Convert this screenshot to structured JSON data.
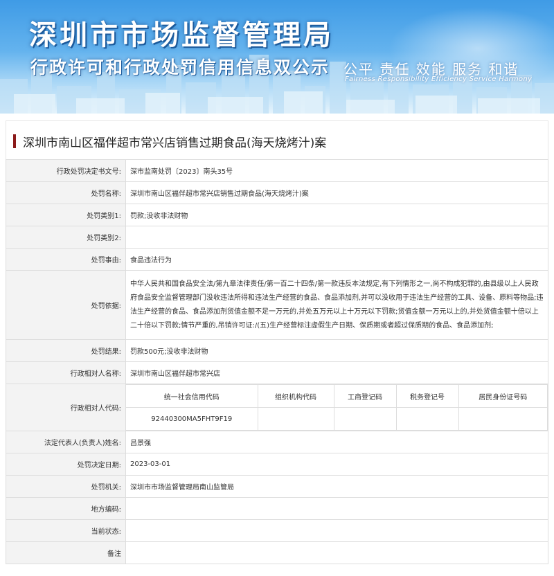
{
  "header": {
    "title": "深圳市市场监督管理局",
    "subtitle": "行政许可和行政处罚信用信息双公示",
    "slogan_cn": "公平  责任  效能  服务  和谐",
    "slogan_en": "Fairness Responsibility Efficiency Service Harmony"
  },
  "case_title": "深圳市南山区福伴超市常兴店销售过期食品(海天烧烤汁)案",
  "fields": {
    "doc_no": {
      "label": "行政处罚决定书文号:",
      "value": "深市监南处罚〔2023〕南头35号"
    },
    "name": {
      "label": "处罚名称:",
      "value": "深圳市南山区福伴超市常兴店销售过期食品(海天烧烤汁)案"
    },
    "cat1": {
      "label": "处罚类别1:",
      "value": "罚款;没收非法财物"
    },
    "cat2": {
      "label": "处罚类别2:",
      "value": ""
    },
    "reason": {
      "label": "处罚事由:",
      "value": "食品违法行为"
    },
    "basis": {
      "label": "处罚依据:",
      "value": "中华人民共和国食品安全法/第九章法律责任/第一百二十四条/第一款违反本法规定,有下列情形之一,尚不构成犯罪的,由县级以上人民政府食品安全监督管理部门没收违法所得和违法生产经营的食品、食品添加剂,并可以没收用于违法生产经营的工具、设备、原料等物品;违法生产经营的食品、食品添加剂货值金额不足一万元的,并处五万元以上十万元以下罚款;货值金额一万元以上的,并处货值金额十倍以上二十倍以下罚款;情节严重的,吊销许可证:/(五)生产经营标注虚假生产日期、保质期或者超过保质期的食品、食品添加剂;"
    },
    "result": {
      "label": "处罚结果:",
      "value": "罚款500元;没收非法财物"
    },
    "party_name": {
      "label": "行政相对人名称:",
      "value": "深圳市南山区福伴超市常兴店"
    },
    "party_code": {
      "label": "行政相对人代码:",
      "headers": [
        "统一社会信用代码",
        "组织机构代码",
        "工商登记码",
        "税务登记号",
        "居民身份证号码"
      ],
      "values": [
        "92440300MA5FHT9F19",
        "",
        "",
        "",
        ""
      ]
    },
    "legal_rep": {
      "label": "法定代表人(负责人)姓名:",
      "value": "吕景强"
    },
    "decision_date": {
      "label": "处罚决定日期:",
      "value": "2023-03-01"
    },
    "authority": {
      "label": "处罚机关:",
      "value": "深圳市市场监督管理局南山监管局"
    },
    "local_code": {
      "label": "地方编码:",
      "value": ""
    },
    "status": {
      "label": "当前状态:",
      "value": ""
    },
    "remark": {
      "label": "备注",
      "value": ""
    }
  },
  "colors": {
    "accent_bar": "#8b1a1a",
    "banner_blue": "#3f9be6",
    "label_bg": "#f3f3f3"
  }
}
